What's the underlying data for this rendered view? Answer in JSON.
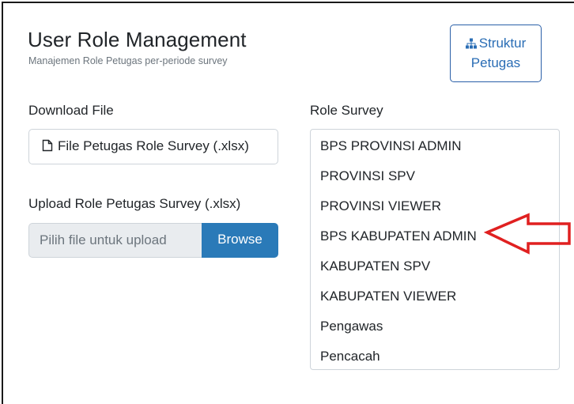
{
  "header": {
    "title": "User Role Management",
    "subtitle": "Manajemen Role Petugas per-periode survey"
  },
  "struktur_button": {
    "label_line1": "Struktur",
    "label_line2": "Petugas",
    "icon": "sitemap-icon"
  },
  "download": {
    "label": "Download File",
    "button_label": "File Petugas Role Survey (.xlsx)",
    "icon": "file-icon"
  },
  "upload": {
    "label": "Upload Role Petugas Survey (.xlsx)",
    "placeholder": "Pilih file untuk upload",
    "browse_label": "Browse"
  },
  "role_survey": {
    "label": "Role Survey",
    "items": [
      "BPS PROVINSI ADMIN",
      "PROVINSI SPV",
      "PROVINSI VIEWER",
      "BPS KABUPATEN ADMIN",
      "KABUPATEN SPV",
      "KABUPATEN VIEWER",
      "Pengawas",
      "Pencacah"
    ]
  },
  "colors": {
    "accent": "#2a7ab8",
    "annotation_arrow": "#e02020"
  }
}
